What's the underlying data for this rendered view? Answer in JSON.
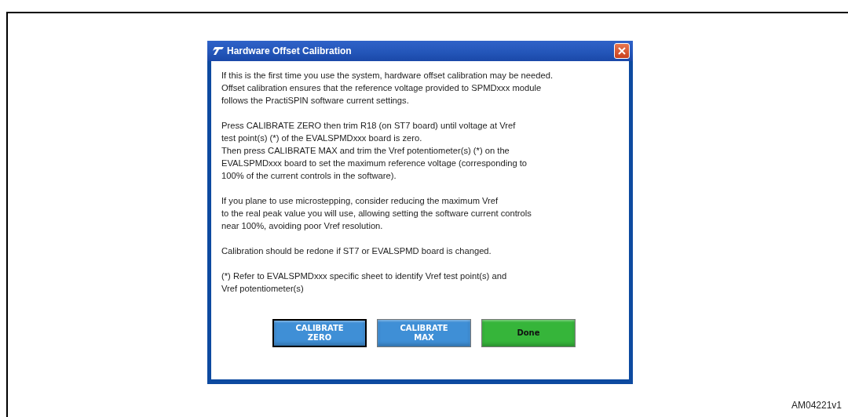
{
  "window": {
    "title": "Hardware Offset Calibration"
  },
  "paragraphs": [
    {
      "lines": [
        "If this is the first time you use the system, hardware offset calibration may be needed.",
        "Offset calibration ensures that the reference voltage provided to SPMDxxx module",
        "follows the PractiSPIN software current settings."
      ]
    },
    {
      "lines": [
        "Press CALIBRATE ZERO then trim R18 (on ST7 board) until voltage at Vref",
        "test point(s) (*) of the EVALSPMDxxx board is zero.",
        "Then  press  CALIBRATE MAX  and  trim the Vref potentiometer(s) (*) on the",
        "EVALSPMDxxx board  to  set the maximum reference voltage (corresponding to",
        "100% of the  current controls in the software)."
      ]
    },
    {
      "lines": [
        "If you plane to use microstepping, consider reducing the maximum Vref",
        "to the real peak value you will use, allowing setting the software current controls",
        "near 100%, avoiding poor Vref resolution."
      ]
    },
    {
      "lines": [
        "Calibration should be redone if ST7 or EVALSPMD board is changed."
      ]
    },
    {
      "lines": [
        "(*) Refer to EVALSPMDxxx specific sheet to identify Vref test point(s) and",
        "Vref potentiometer(s)"
      ]
    }
  ],
  "buttons": [
    {
      "lines": [
        "CALIBRATE",
        "ZERO"
      ],
      "color": "#3f8fd6",
      "focused": true
    },
    {
      "lines": [
        "CALIBRATE",
        "MAX"
      ],
      "color": "#3f8fd6",
      "focused": false
    },
    {
      "lines": [
        "Done"
      ],
      "color": "#36b53a",
      "focused": false
    }
  ],
  "figure_id": "AM04221v1"
}
